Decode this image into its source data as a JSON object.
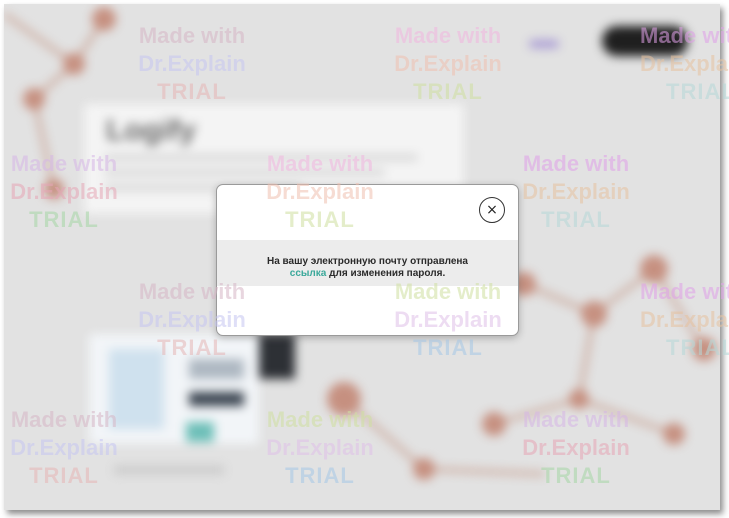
{
  "background": {
    "brand_name": "Logify",
    "colors": {
      "backdrop": "#e2e2e2",
      "nodes": "#c08a7a",
      "accent": "#3aa89a"
    }
  },
  "dialog": {
    "close_icon": "×",
    "message_line1": "На вашу электронную почту отправлена",
    "message_link": "ссылка",
    "message_rest": " для изменения пароля."
  },
  "watermark": {
    "line1": "Made with",
    "line2": "Dr.Explain",
    "line3": "TRIAL"
  }
}
